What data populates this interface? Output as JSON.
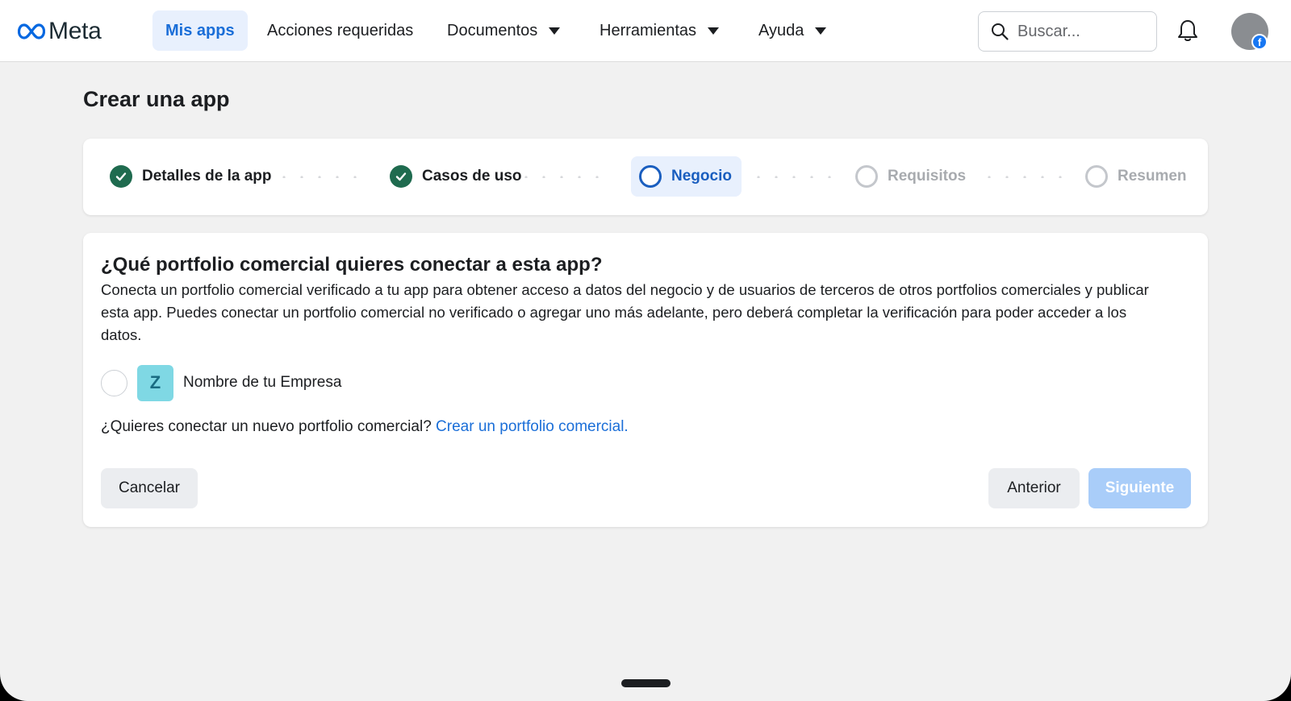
{
  "nav": {
    "brand": "Meta",
    "items": [
      {
        "label": "Mis apps",
        "active": true,
        "dropdown": false
      },
      {
        "label": "Acciones requeridas",
        "active": false,
        "dropdown": false
      },
      {
        "label": "Documentos",
        "active": false,
        "dropdown": true
      },
      {
        "label": "Herramientas",
        "active": false,
        "dropdown": true
      },
      {
        "label": "Ayuda",
        "active": false,
        "dropdown": true
      }
    ],
    "search_placeholder": "Buscar...",
    "icons": {
      "search": "search-icon",
      "notifications": "bell-icon",
      "avatar_badge": "facebook-icon"
    }
  },
  "page": {
    "title": "Crear una app"
  },
  "stepper": {
    "steps": [
      {
        "label": "Detalles de la app",
        "status": "completed"
      },
      {
        "label": "Casos de uso",
        "status": "completed"
      },
      {
        "label": "Negocio",
        "status": "current"
      },
      {
        "label": "Requisitos",
        "status": "pending"
      },
      {
        "label": "Resumen",
        "status": "pending"
      }
    ]
  },
  "main": {
    "question": "¿Qué portfolio comercial quieres conectar a esta app?",
    "description": "Conecta un portfolio comercial verificado a tu app para obtener acceso a datos del negocio y de usuarios de terceros de otros portfolios comerciales y publicar esta app. Puedes conectar un portfolio comercial no verificado o agregar uno más adelante, pero deberá completar la verificación para poder acceder a los datos.",
    "business_option": {
      "initial": "Z",
      "name": "Nombre de tu Empresa",
      "selected": false
    },
    "create_prompt": "¿Quieres conectar un nuevo portfolio comercial?",
    "create_link": "Crear un portfolio comercial."
  },
  "buttons": {
    "cancel": "Cancelar",
    "previous": "Anterior",
    "next": "Siguiente",
    "next_enabled": false
  },
  "colors": {
    "accent": "#1a6ed8",
    "completed": "#1f6b4f",
    "active_bg": "#e8f0fd",
    "next_disabled": "#a9cdf9",
    "business_avatar": "#7fd8e4"
  }
}
